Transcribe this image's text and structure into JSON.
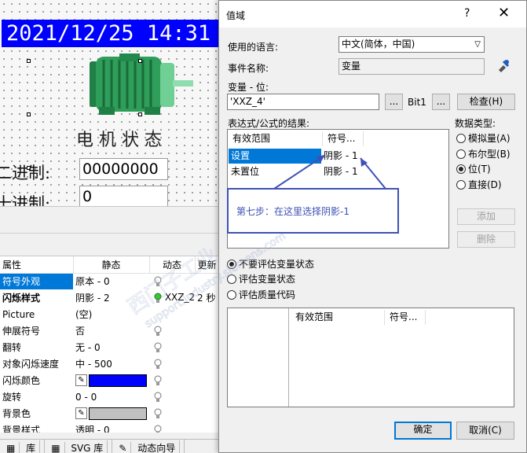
{
  "canvas": {
    "clock": "2021/12/25  14:31",
    "motor_title": "电机状态",
    "binary_label": "二进制:",
    "binary_value": "00000000",
    "decimal_label": "十进制:",
    "decimal_value": "0"
  },
  "properties": {
    "headers": [
      "属性",
      "静态",
      "动态",
      "更新"
    ],
    "rows": [
      {
        "name": "符号外观",
        "static": "原本 - 0",
        "dynamic": "",
        "update": ""
      },
      {
        "name": "闪烁样式",
        "static": "阴影 - 2",
        "dynamic": "XXZ_2",
        "update": "2 秒"
      },
      {
        "name": "Picture",
        "static": "(空)",
        "dynamic": "",
        "update": ""
      },
      {
        "name": "伸展符号",
        "static": "否",
        "dynamic": "",
        "update": ""
      },
      {
        "name": "翻转",
        "static": "无 - 0",
        "dynamic": "",
        "update": ""
      },
      {
        "name": "对象闪烁速度",
        "static": "中 - 500",
        "dynamic": "",
        "update": ""
      },
      {
        "name": "闪烁颜色",
        "static": "",
        "dynamic": "",
        "update": ""
      },
      {
        "name": "旋转",
        "static": "0 - 0",
        "dynamic": "",
        "update": ""
      },
      {
        "name": "背景色",
        "static": "",
        "dynamic": "",
        "update": ""
      },
      {
        "name": "背景样式",
        "static": "透明 - 0",
        "dynamic": "",
        "update": ""
      }
    ],
    "flash_color": "#0000ff",
    "background_color": "#c0c0c0"
  },
  "bottom_tabs": [
    "库",
    "SVG 库",
    "动态向导"
  ],
  "dialog": {
    "title": "值域",
    "help": "?",
    "close": "✕",
    "language_label": "使用的语言:",
    "language_value": "中文(简体，中国)",
    "event_label": "事件名称:",
    "event_value": "变量",
    "variable_label": "变量 - 位:",
    "variable_value": "'XXZ_4'",
    "browse_label": "...",
    "bit_label": "Bit1",
    "bit_browse_label": "...",
    "check_label": "检查(H)",
    "result_label": "表达式/公式的结果:",
    "result_headers": [
      "有效范围",
      "符号..."
    ],
    "result_rows": [
      {
        "range": "设置",
        "symbol": "阴影 - 1"
      },
      {
        "range": "未置位",
        "symbol": "阴影 - 1"
      }
    ],
    "annotation": "第七步：在这里选择阴影-1",
    "datatype_label": "数据类型:",
    "datatypes": [
      {
        "label": "模拟量(A)",
        "checked": false
      },
      {
        "label": "布尔型(B)",
        "checked": false
      },
      {
        "label": "位(T)",
        "checked": true
      },
      {
        "label": "直接(D)",
        "checked": false
      }
    ],
    "add_label": "添加",
    "delete_label": "删除",
    "eval_options": [
      {
        "label": "不要评估变量状态",
        "checked": true
      },
      {
        "label": "评估变量状态",
        "checked": false
      },
      {
        "label": "评估质量代码",
        "checked": false
      }
    ],
    "quality_headers": [
      "有效范围",
      "符号..."
    ],
    "ok_label": "确定",
    "cancel_label": "取消(C)"
  },
  "colors": {
    "clock_bg": "#0000ff",
    "selection": "#0078d7",
    "annotation": "#3f51b5",
    "motor": "#2e9e5a"
  }
}
